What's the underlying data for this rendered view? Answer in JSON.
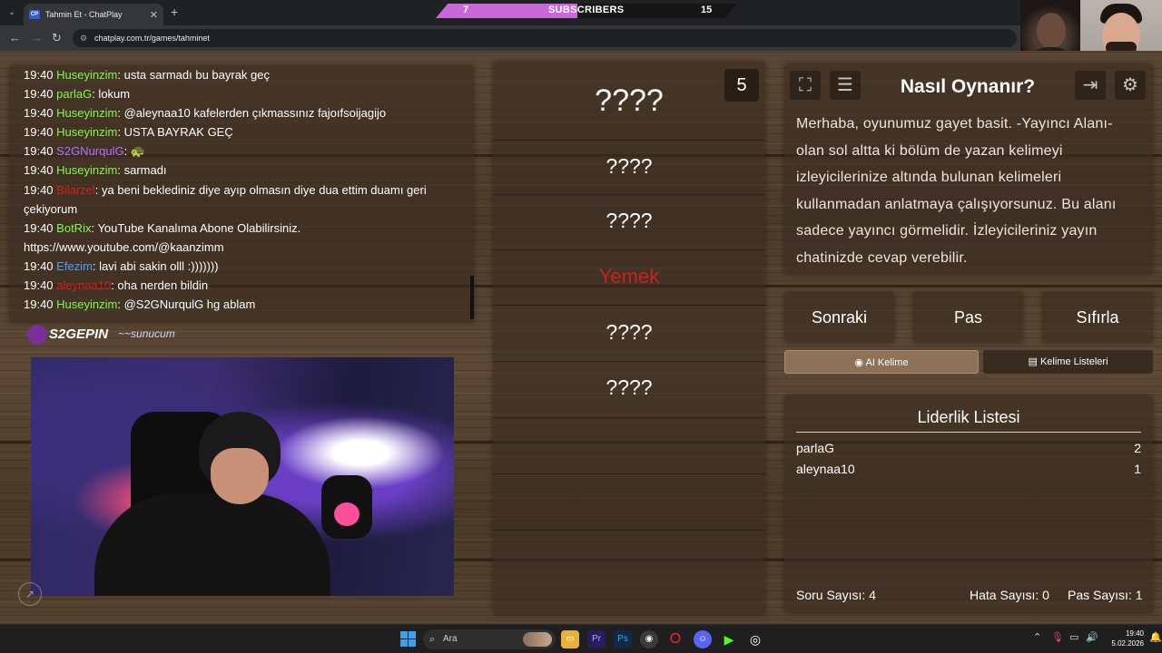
{
  "browser": {
    "tab_title": "Tahmin Et - ChatPlay",
    "tab_favicon": "CP",
    "url": "chatplay.com.tr/games/tahminet"
  },
  "subscribers": {
    "current": "7",
    "label": "SUBSCRIBERS",
    "goal": "15",
    "progress_fraction": 0.47,
    "bar_color": "#c867d8"
  },
  "chat": {
    "messages": [
      {
        "time": "19:40",
        "user": "Huseyinzim",
        "color": "#7cfc4a",
        "text": ": usta sarmadı bu bayrak geç"
      },
      {
        "time": "19:40",
        "user": "parlaG",
        "color": "#7cfc4a",
        "text": ": lokum"
      },
      {
        "time": "19:40",
        "user": "Huseyinzim",
        "color": "#7cfc4a",
        "text": ": @aleynaa10 kafelerden çıkmassınız fajoıfsoijagijo"
      },
      {
        "time": "19:40",
        "user": "Huseyinzim",
        "color": "#7cfc4a",
        "text": ": USTA BAYRAK GEÇ"
      },
      {
        "time": "19:40",
        "user": "S2GNurqulG",
        "color": "#b070ff",
        "text": ": 🐢"
      },
      {
        "time": "19:40",
        "user": "Huseyinzim",
        "color": "#7cfc4a",
        "text": ": sarmadı"
      },
      {
        "time": "19:40",
        "user": "Bilarzel",
        "color": "#d42020",
        "text": ": ya beni beklediniz diye ayıp olmasın diye dua ettim duamı geri çekiyorum"
      },
      {
        "time": "19:40",
        "user": "BotRix",
        "color": "#7cfc4a",
        "text": ": YouTube Kanalıma Abone Olabilirsiniz. https://www.youtube.com/@kaanzimm"
      },
      {
        "time": "19:40",
        "user": "Efezim",
        "color": "#4aa0ff",
        "text": ": lavi abi sakin olll :)))))))"
      },
      {
        "time": "19:40",
        "user": "aleynaa10",
        "color": "#d42020",
        "text": ": oha nerden bildin"
      },
      {
        "time": "19:40",
        "user": "Huseyinzim",
        "color": "#7cfc4a",
        "text": ": @S2GNurqulG hg ablam"
      }
    ]
  },
  "sponsors": {
    "first": "S2GEPIN",
    "second": "sunucum"
  },
  "words": {
    "timer": "5",
    "items": [
      "????",
      "????",
      "????",
      "Yemek",
      "????",
      "????"
    ],
    "highlight_color": "#cc1f1f"
  },
  "howto": {
    "title": "Nasıl Oynanır?",
    "text": "Merhaba, oyunumuz gayet basit. -Yayıncı Alanı- olan sol altta ki bölüm de yazan kelimeyi izleyicilerinize altında bulunan kelimeleri kullanmadan anlatmaya çalışıyorsunuz. Bu alanı sadece yayıncı görmelidir. İzleyicileriniz yayın chatinizde cevap verebilir.",
    "icons": [
      "fullscreen-icon",
      "list-icon",
      "logout-icon",
      "gear-icon"
    ]
  },
  "actions": {
    "next": "Sonraki",
    "pass": "Pas",
    "reset": "Sıfırla"
  },
  "tabs": {
    "ai_word": "AI Kelime",
    "word_lists": "Kelime Listeleri"
  },
  "leaderboard": {
    "title": "Liderlik Listesi",
    "rows": [
      {
        "name": "parlaG",
        "points": "2"
      },
      {
        "name": "aleynaa10",
        "points": "1"
      }
    ],
    "question_count": "Soru Sayısı: 4",
    "error_count": "Hata Sayısı: 0",
    "pass_count": "Pas Sayısı: 1"
  },
  "taskbar": {
    "search_placeholder": "Ara",
    "time": "19:40",
    "date": "5.02.2026"
  }
}
